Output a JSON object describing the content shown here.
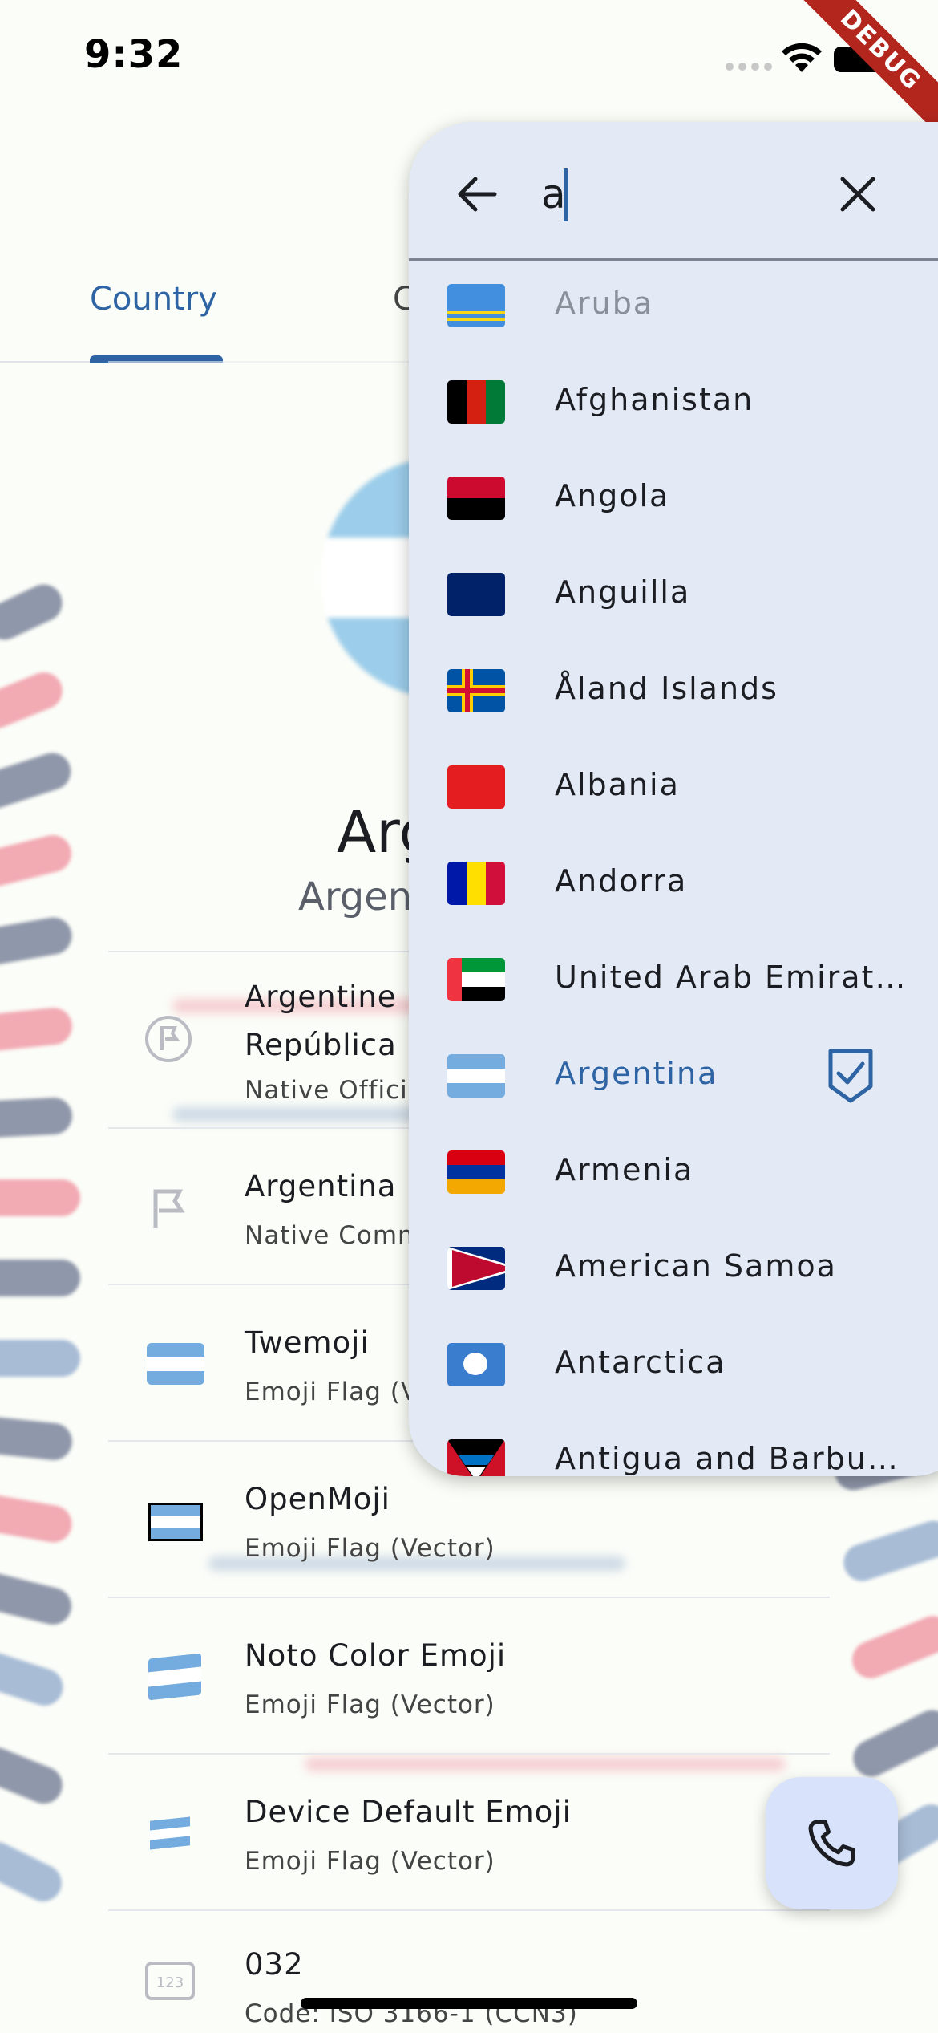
{
  "status_bar": {
    "time": "9:32",
    "debug_label": "DEBUG"
  },
  "tabs": {
    "country": "Country",
    "other_partial": "C"
  },
  "detail": {
    "title_partial": "Arg",
    "subtitle_partial": "Argent",
    "rows": [
      {
        "title": "Argentine",
        "title2": "República",
        "subtitle": "Native Offici",
        "icon": "flag-outline-icon"
      },
      {
        "title": "Argentina",
        "subtitle": "Native Comm",
        "icon": "flag-icon"
      },
      {
        "title": "Twemoji",
        "subtitle": "Emoji Flag (V",
        "icon": "argentina-flag"
      },
      {
        "title": "OpenMoji",
        "subtitle": "Emoji Flag (Vector)",
        "icon": "argentina-flag"
      },
      {
        "title": "Noto Color Emoji",
        "subtitle": "Emoji Flag (Vector)",
        "icon": "argentina-flag"
      },
      {
        "title": "Device Default Emoji",
        "subtitle": "Emoji Flag (Vector)",
        "icon": "argentina-flag"
      },
      {
        "title": "032",
        "subtitle": "Code: ISO 3166-1 (CCN3)",
        "icon": "number-123-icon"
      }
    ]
  },
  "search": {
    "query": "a",
    "back_icon": "arrow-left-icon",
    "clear_icon": "close-icon",
    "results": [
      {
        "label": "Aruba",
        "state": "faded"
      },
      {
        "label": "Afghanistan"
      },
      {
        "label": "Angola"
      },
      {
        "label": "Anguilla"
      },
      {
        "label": "Åland Islands"
      },
      {
        "label": "Albania"
      },
      {
        "label": "Andorra"
      },
      {
        "label": "United Arab Emirat…"
      },
      {
        "label": "Argentina",
        "state": "selected"
      },
      {
        "label": "Armenia"
      },
      {
        "label": "American Samoa"
      },
      {
        "label": "Antarctica"
      },
      {
        "label": "Antigua and Barbu…"
      }
    ]
  },
  "fab": {
    "icon": "phone-icon"
  },
  "colors": {
    "accent": "#2e64a4",
    "panel": "#e3eaf5",
    "fab": "#d8e3fb",
    "background": "#fbfdf8"
  }
}
